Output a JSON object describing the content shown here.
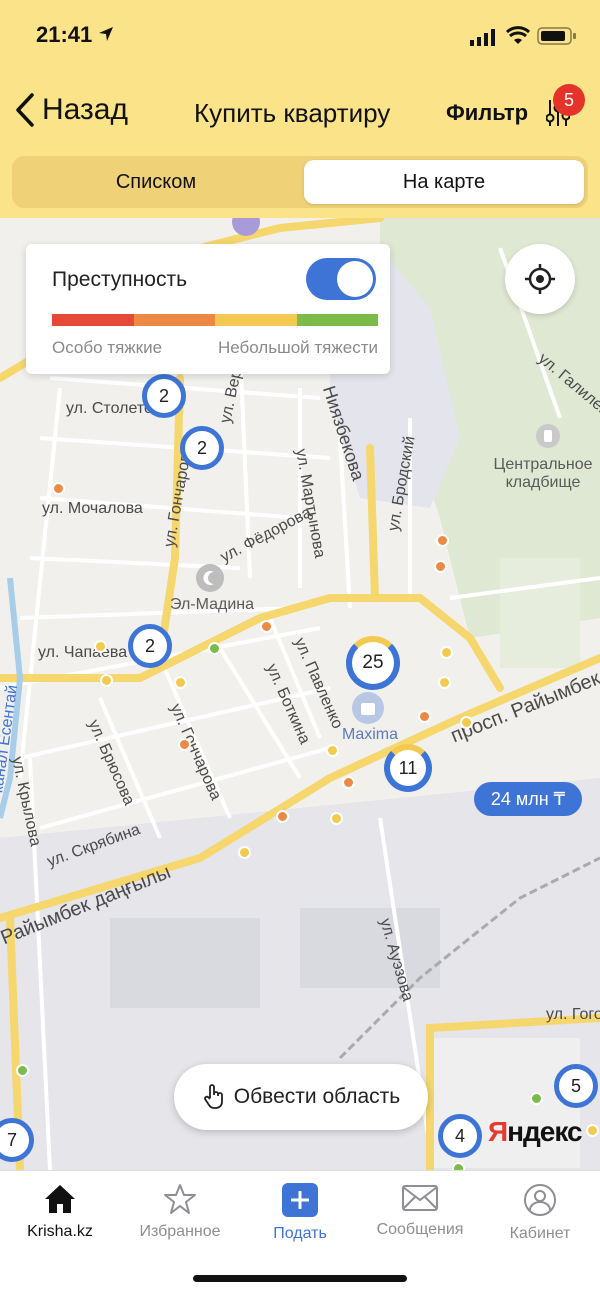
{
  "status_bar": {
    "time": "21:41"
  },
  "nav": {
    "back_label": "Назад",
    "title": "Купить квартиру",
    "filter_label": "Фильтр",
    "filter_count": "5"
  },
  "segments": {
    "list": "Списком",
    "map": "На карте",
    "active": "map"
  },
  "legend": {
    "title": "Преступность",
    "toggle_on": true,
    "left_label": "Особо тяжкие",
    "right_label": "Небольшой тяжести",
    "colors": [
      "#e5493a",
      "#ec8a45",
      "#f3c94f",
      "#7bbb49"
    ]
  },
  "map": {
    "streets": [
      "ул. Столетова",
      "ул. Гончарова",
      "ул. Мочалова",
      "ул. Фёдорова",
      "ул. Мартынова",
      "ул. Бродский",
      "ул. Чапаева",
      "ул. Брюсова",
      "ул. Гончарова",
      "ул. Боткина",
      "ул. Павленко",
      "ул. Скрябина",
      "Райымбек даңғылы",
      "просп. Райымбек",
      "ул. Ауэзова",
      "ул. Крылова",
      "канал Есентай",
      "Ниязбекова",
      "ул. Галилей",
      "ул. Гоголя",
      "ул. Верди"
    ],
    "places": [
      "Центральное кладбище",
      "Эл-Мадина",
      "Maxima"
    ],
    "clusters": [
      "2",
      "2",
      "2",
      "25",
      "11",
      "5",
      "4",
      "7"
    ],
    "price_pill": "24 млн ₸",
    "draw_area_label": "Обвести область",
    "attribution": {
      "part1": "Я",
      "part2": "ндекс"
    }
  },
  "tabbar": {
    "items": [
      {
        "label": "Krisha.kz",
        "active": true
      },
      {
        "label": "Избранное",
        "active": false
      },
      {
        "label": "Подать",
        "active": false
      },
      {
        "label": "Сообщения",
        "active": false
      },
      {
        "label": "Кабинет",
        "active": false
      }
    ],
    "accent": "#3d74d6"
  }
}
